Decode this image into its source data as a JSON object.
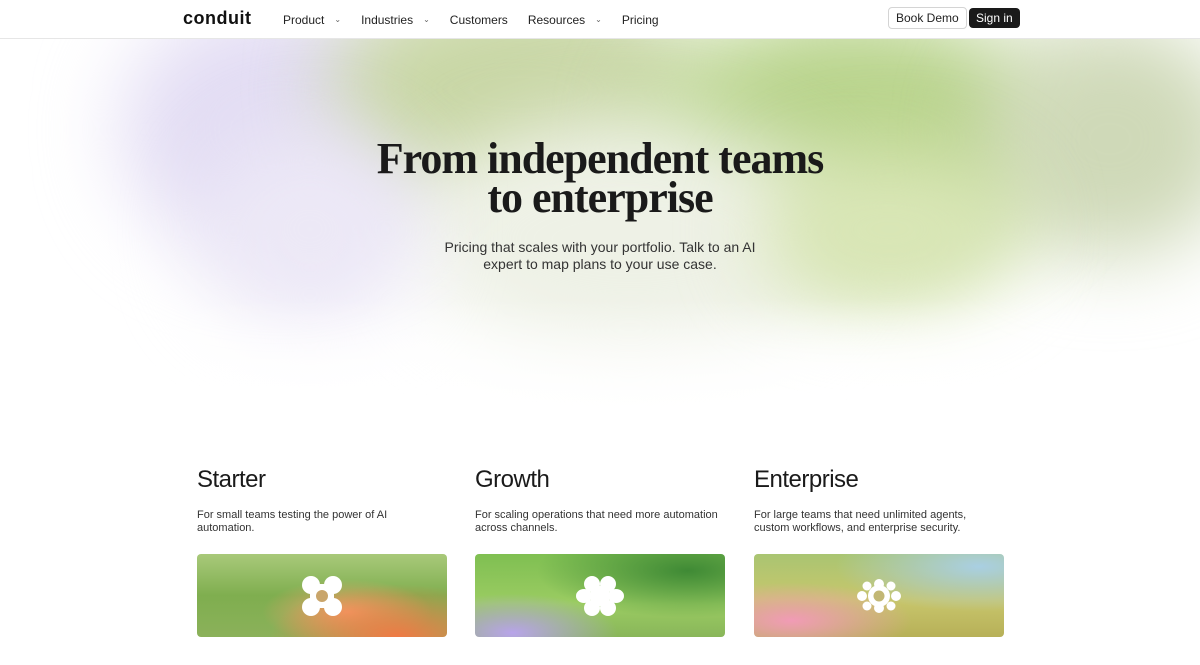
{
  "nav": {
    "logo": "conduit",
    "items": [
      {
        "label": "Product",
        "has_dropdown": true
      },
      {
        "label": "Industries",
        "has_dropdown": true
      },
      {
        "label": "Customers",
        "has_dropdown": false
      },
      {
        "label": "Resources",
        "has_dropdown": true
      },
      {
        "label": "Pricing",
        "has_dropdown": false
      }
    ],
    "book_demo": "Book Demo",
    "sign_in": "Sign in"
  },
  "hero": {
    "title": "From independent teams to enterprise",
    "subtitle": "Pricing that scales with your portfolio. Talk to an AI expert to map plans to your use case."
  },
  "plans": [
    {
      "name": "Starter",
      "description": "For small teams testing the power of AI automation.",
      "icon": "four-petal-icon"
    },
    {
      "name": "Growth",
      "description": "For scaling operations that need more automation across channels.",
      "icon": "six-petal-icon"
    },
    {
      "name": "Enterprise",
      "description": "For large teams that need unlimited agents, custom workflows, and enterprise security.",
      "icon": "eight-petal-icon"
    }
  ],
  "colors": {
    "text": "#1a1a1a",
    "sign_in_bg": "#1a1a1a"
  }
}
